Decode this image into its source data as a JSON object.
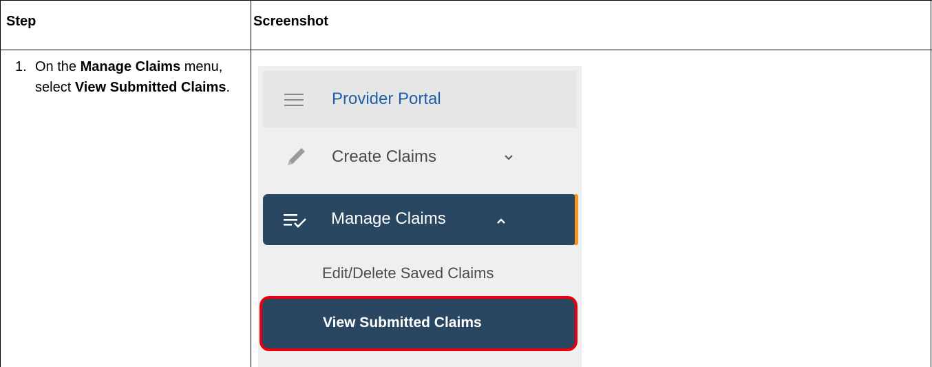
{
  "table": {
    "header_step": "Step",
    "header_screenshot": "Screenshot"
  },
  "step": {
    "number": "1.",
    "text_1": "On the ",
    "bold_1": "Manage Claims",
    "text_2": " menu, select ",
    "bold_2": "View Submitted Claims",
    "text_3": "."
  },
  "screenshot": {
    "portal_title": "Provider Portal",
    "menu": {
      "create_claims": "Create Claims",
      "manage_claims": "Manage Claims",
      "edit_delete": "Edit/Delete Saved Claims",
      "view_submitted": "View Submitted Claims"
    },
    "colors": {
      "nav_dark": "#294761",
      "accent_orange": "#f7941d",
      "highlight_red": "#e60012",
      "portal_blue": "#1f5ea8"
    },
    "icons": [
      "hamburger-icon",
      "pencil-icon",
      "chevron-down-icon",
      "checklist-icon",
      "chevron-up-icon"
    ]
  }
}
